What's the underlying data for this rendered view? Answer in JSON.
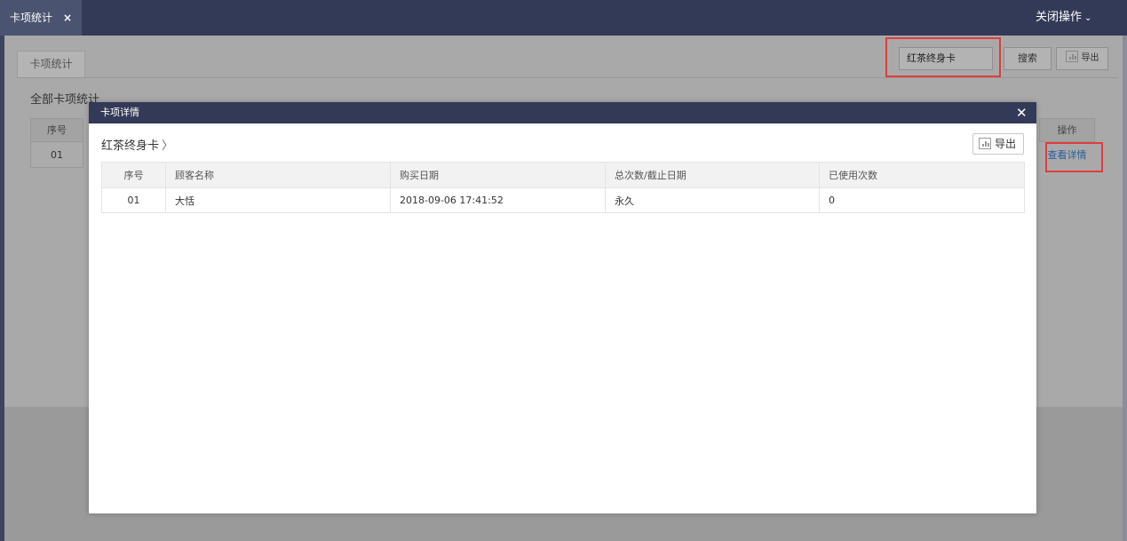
{
  "topbar": {
    "tab_label": "卡项统计",
    "tab_close": "×",
    "close_ops_label": "关闭操作",
    "close_ops_caret": "⌄"
  },
  "background": {
    "subtab_label": "卡项统计",
    "section_title": "全部卡项统计",
    "search_value": "红茶终身卡",
    "search_button": "搜索",
    "export_button": "导出",
    "table": {
      "columns": [
        "序号",
        "操作"
      ],
      "rows": [
        {
          "index": "01",
          "action": "查看详情"
        }
      ]
    }
  },
  "modal": {
    "title": "卡项详情",
    "close": "✕",
    "breadcrumb": "红茶终身卡",
    "breadcrumb_sep": "〉",
    "export_label": "导出",
    "columns": [
      "序号",
      "顾客名称",
      "购买日期",
      "总次数/截止日期",
      "已使用次数"
    ],
    "rows": [
      [
        "01",
        "大恬",
        "2018-09-06 17:41:52",
        "永久",
        "0"
      ]
    ]
  },
  "colors": {
    "header_navy": "#333a57",
    "highlight_red": "#e03c3c",
    "link_blue": "#2a5d9c"
  }
}
